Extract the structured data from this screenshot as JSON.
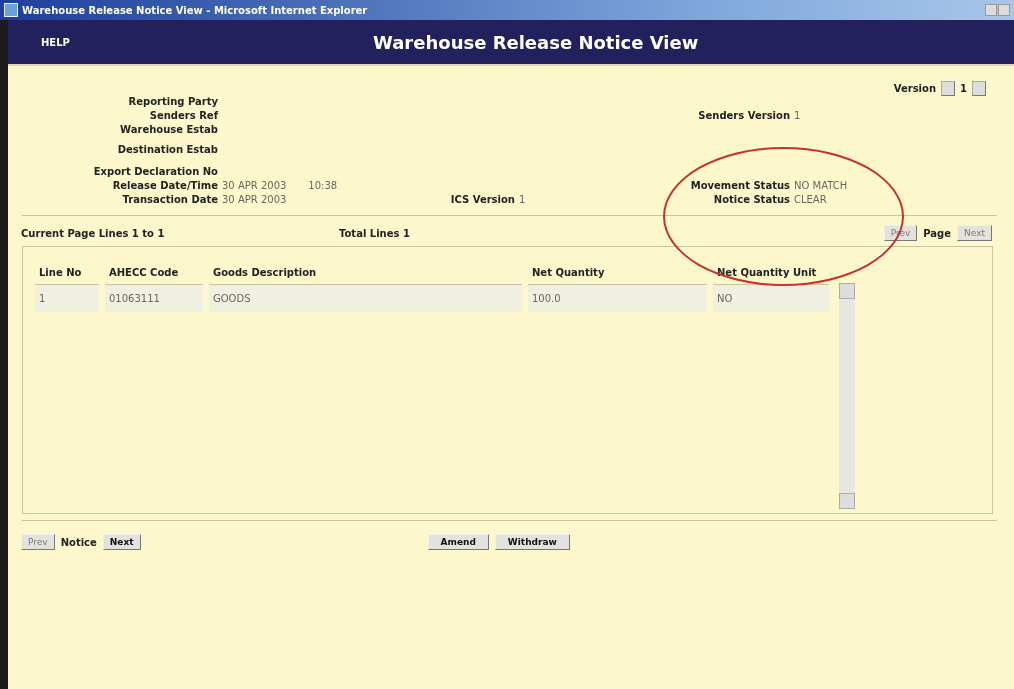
{
  "window": {
    "title": "Warehouse Release Notice View - Microsoft Internet Explorer"
  },
  "header": {
    "help_link": "HELP",
    "title": "Warehouse Release Notice View"
  },
  "version_nav": {
    "label": "Version",
    "value": "1"
  },
  "detail_rows": [
    {
      "left": {
        "label": "Reporting Party"
      }
    },
    {
      "left": {
        "label": "Senders Ref"
      },
      "right": {
        "label": "Senders Version",
        "values": [
          "1"
        ]
      }
    },
    {
      "left": {
        "label": "Warehouse Estab"
      }
    },
    {
      "left": {
        "label": "Destination Estab"
      }
    },
    {
      "left": {
        "label": "Export Declaration No"
      }
    },
    {
      "left": {
        "label": "Release Date/Time",
        "values": [
          "30 APR 2003",
          "10:38"
        ]
      },
      "right": {
        "label": "Movement Status",
        "values": [
          "NO MATCH"
        ]
      }
    },
    {
      "left": {
        "label": "Transaction Date",
        "values": [
          "30 APR 2003"
        ]
      },
      "middle": {
        "label": "ICS Version",
        "values": [
          "1"
        ]
      },
      "right": {
        "label": "Notice Status",
        "values": [
          "CLEAR"
        ]
      }
    }
  ],
  "annotation": {
    "kind": "ellipse",
    "color": "#c8302c"
  },
  "lines_info": {
    "current": "Current Page Lines 1 to 1",
    "total": "Total Lines 1",
    "prev": {
      "label": "Prev",
      "disabled": true
    },
    "page_label": "Page",
    "next": {
      "label": "Next",
      "disabled": true
    }
  },
  "table": {
    "columns": [
      "Line No",
      "AHECC Code",
      "Goods Description",
      "Net Quantity",
      "Net Quantity Unit"
    ],
    "rows": [
      [
        "1",
        "01063111",
        "GOODS",
        "100.0",
        "NO"
      ]
    ]
  },
  "notice_nav": {
    "prev": {
      "label": "Prev",
      "disabled": true
    },
    "label": "Notice",
    "next": {
      "label": "Next",
      "disabled": false
    }
  },
  "actions": [
    "Amend",
    "Withdraw"
  ]
}
